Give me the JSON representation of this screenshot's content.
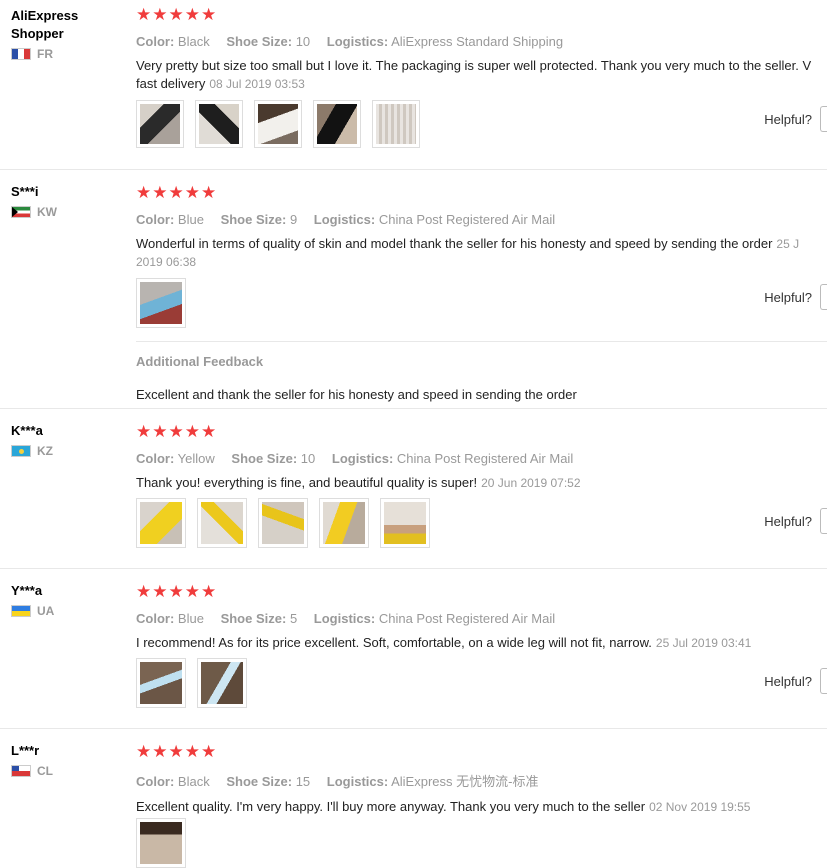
{
  "labels": {
    "color": "Color:",
    "shoe_size": "Shoe Size:",
    "logistics": "Logistics:",
    "helpful": "Helpful?",
    "additional_feedback": "Additional Feedback",
    "stars": "★★★★★"
  },
  "reviews": [
    {
      "user": "AliExpress Shopper",
      "country": "FR",
      "color": "Black",
      "size": "10",
      "logistics": "AliExpress Standard Shipping",
      "text": "Very pretty but size too small but I love it. The packaging is super well protected. Thank you very much to the seller. V",
      "text2": "fast delivery",
      "date": "08 Jul 2019 03:53"
    },
    {
      "user": "S***i",
      "country": "KW",
      "color": "Blue",
      "size": "9",
      "logistics": "China Post Registered Air Mail",
      "text": "Wonderful in terms of quality of skin and model thank the seller for his honesty and speed by sending the order",
      "date_a": "25 J",
      "date_b": "2019 06:38",
      "additional": "Excellent and thank the seller for his honesty and speed in sending the order"
    },
    {
      "user": "K***a",
      "country": "KZ",
      "color": "Yellow",
      "size": "10",
      "logistics": "China Post Registered Air Mail",
      "text": "Thank you! everything is fine, and beautiful quality is super!",
      "date": "20 Jun 2019 07:52"
    },
    {
      "user": "Y***a",
      "country": "UA",
      "color": "Blue",
      "size": "5",
      "logistics": "China Post Registered Air Mail",
      "text": "I recommend! As for its price excellent. Soft, comfortable, on a wide leg will not fit, narrow.",
      "date": "25 Jul 2019 03:41"
    },
    {
      "user": "L***r",
      "country": "CL",
      "color": "Black",
      "size": "15",
      "logistics": "AliExpress 无忧物流-标准",
      "text": "Excellent quality. I'm very happy. I'll buy more anyway. Thank you very much to the seller",
      "date": "02 Nov 2019 19:55"
    }
  ]
}
